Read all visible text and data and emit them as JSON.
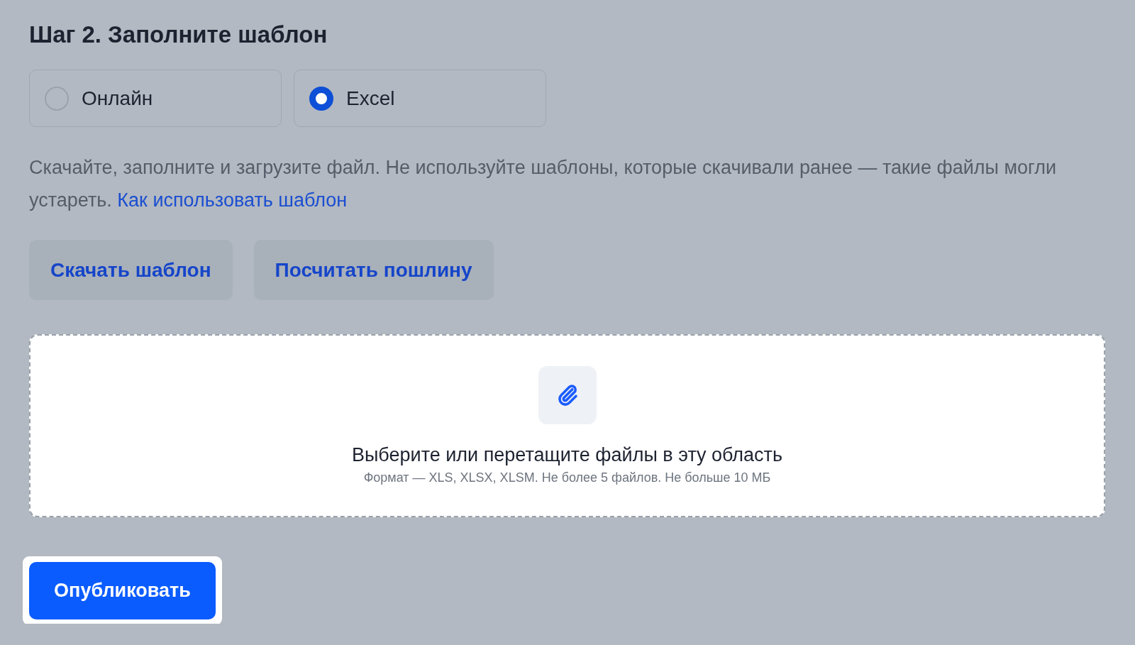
{
  "title": "Шаг 2. Заполните шаблон",
  "options": [
    {
      "label": "Онлайн",
      "selected": false
    },
    {
      "label": "Excel",
      "selected": true
    }
  ],
  "description": {
    "text": "Скачайте, заполните и загрузите файл. Не используйте шаблоны, которые скачивали ранее — такие файлы могли устареть.",
    "link": "Как использовать шаблон"
  },
  "buttons": [
    "Скачать шаблон",
    "Посчитать пошлину"
  ],
  "upload": {
    "title": "Выберите или перетащите файлы в эту область",
    "hint": "Формат — XLS, XLSX, XLSM. Не более 5 файлов. Не больше 10 МБ"
  },
  "publish_button": "Опубликовать"
}
